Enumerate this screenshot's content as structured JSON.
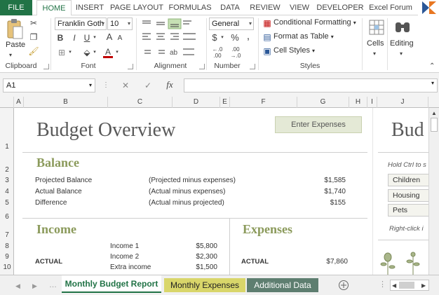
{
  "ribbon_tabs": [
    "FILE",
    "HOME",
    "INSERT",
    "PAGE LAYOUT",
    "FORMULAS",
    "DATA",
    "REVIEW",
    "VIEW",
    "DEVELOPER",
    "Excel Forum"
  ],
  "ribbon": {
    "clipboard": {
      "paste_label": "Paste",
      "group_label": "Clipboard"
    },
    "font": {
      "font_name": "Franklin Goth",
      "font_size": "10",
      "bold": "B",
      "italic": "I",
      "underline": "U",
      "grow": "A",
      "shrink": "A",
      "font_color": "A",
      "group_label": "Font"
    },
    "alignment": {
      "group_label": "Alignment"
    },
    "number": {
      "format": "General",
      "currency": "$",
      "percent": "%",
      "comma": ",",
      "inc_decimal": "←.0 .00",
      "dec_decimal": ".00 →.0",
      "group_label": "Number"
    },
    "styles": {
      "conditional": "Conditional Formatting",
      "format_table": "Format as Table",
      "cell_styles": "Cell Styles",
      "group_label": "Styles"
    },
    "cells": {
      "label": "Cells"
    },
    "editing": {
      "label": "Editing"
    }
  },
  "formula_bar": {
    "name_box": "A1",
    "fx": "fx",
    "cancel": "✕",
    "enter": "✓",
    "formula": ""
  },
  "columns": [
    "A",
    "B",
    "C",
    "D",
    "E",
    "F",
    "G",
    "H",
    "I",
    "J"
  ],
  "rows": [
    "1",
    "2",
    "3",
    "4",
    "5",
    "6",
    "7",
    "8",
    "9",
    "10"
  ],
  "sheet": {
    "title": "Budget Overview",
    "enter_expenses": "Enter Expenses",
    "balance": {
      "heading": "Balance",
      "rows": [
        {
          "label": "Projected Balance",
          "desc": "(Projected  minus expenses)",
          "value": "$1,585"
        },
        {
          "label": "Actual Balance",
          "desc": "(Actual  minus expenses)",
          "value": "$1,740"
        },
        {
          "label": "Difference",
          "desc": "(Actual minus projected)",
          "value": "$155"
        }
      ]
    },
    "income": {
      "heading": "Income",
      "actual_label": "ACTUAL",
      "rows": [
        {
          "label": "Income 1",
          "value": "$5,800"
        },
        {
          "label": "Income 2",
          "value": "$2,300"
        },
        {
          "label": "Extra income",
          "value": "$1,500"
        }
      ]
    },
    "expenses": {
      "heading": "Expenses",
      "actual_label": "ACTUAL",
      "value": "$7,860"
    },
    "side_panel": {
      "title": "Bud",
      "hint": "Hold Ctrl to s",
      "items": [
        "Children",
        "Housing",
        "Pets"
      ],
      "hint2": "Right-click i"
    }
  },
  "sheet_tabs": [
    {
      "label": "Monthly Budget Report",
      "active": true
    },
    {
      "label": "Monthly Expenses",
      "active": false
    },
    {
      "label": "Additional Data",
      "active": false
    }
  ],
  "colors": {
    "excel_green": "#217346",
    "section_olive": "#8b9a5b",
    "tab_yellow": "#d9d66a",
    "tab_grey": "#5e7e70"
  }
}
